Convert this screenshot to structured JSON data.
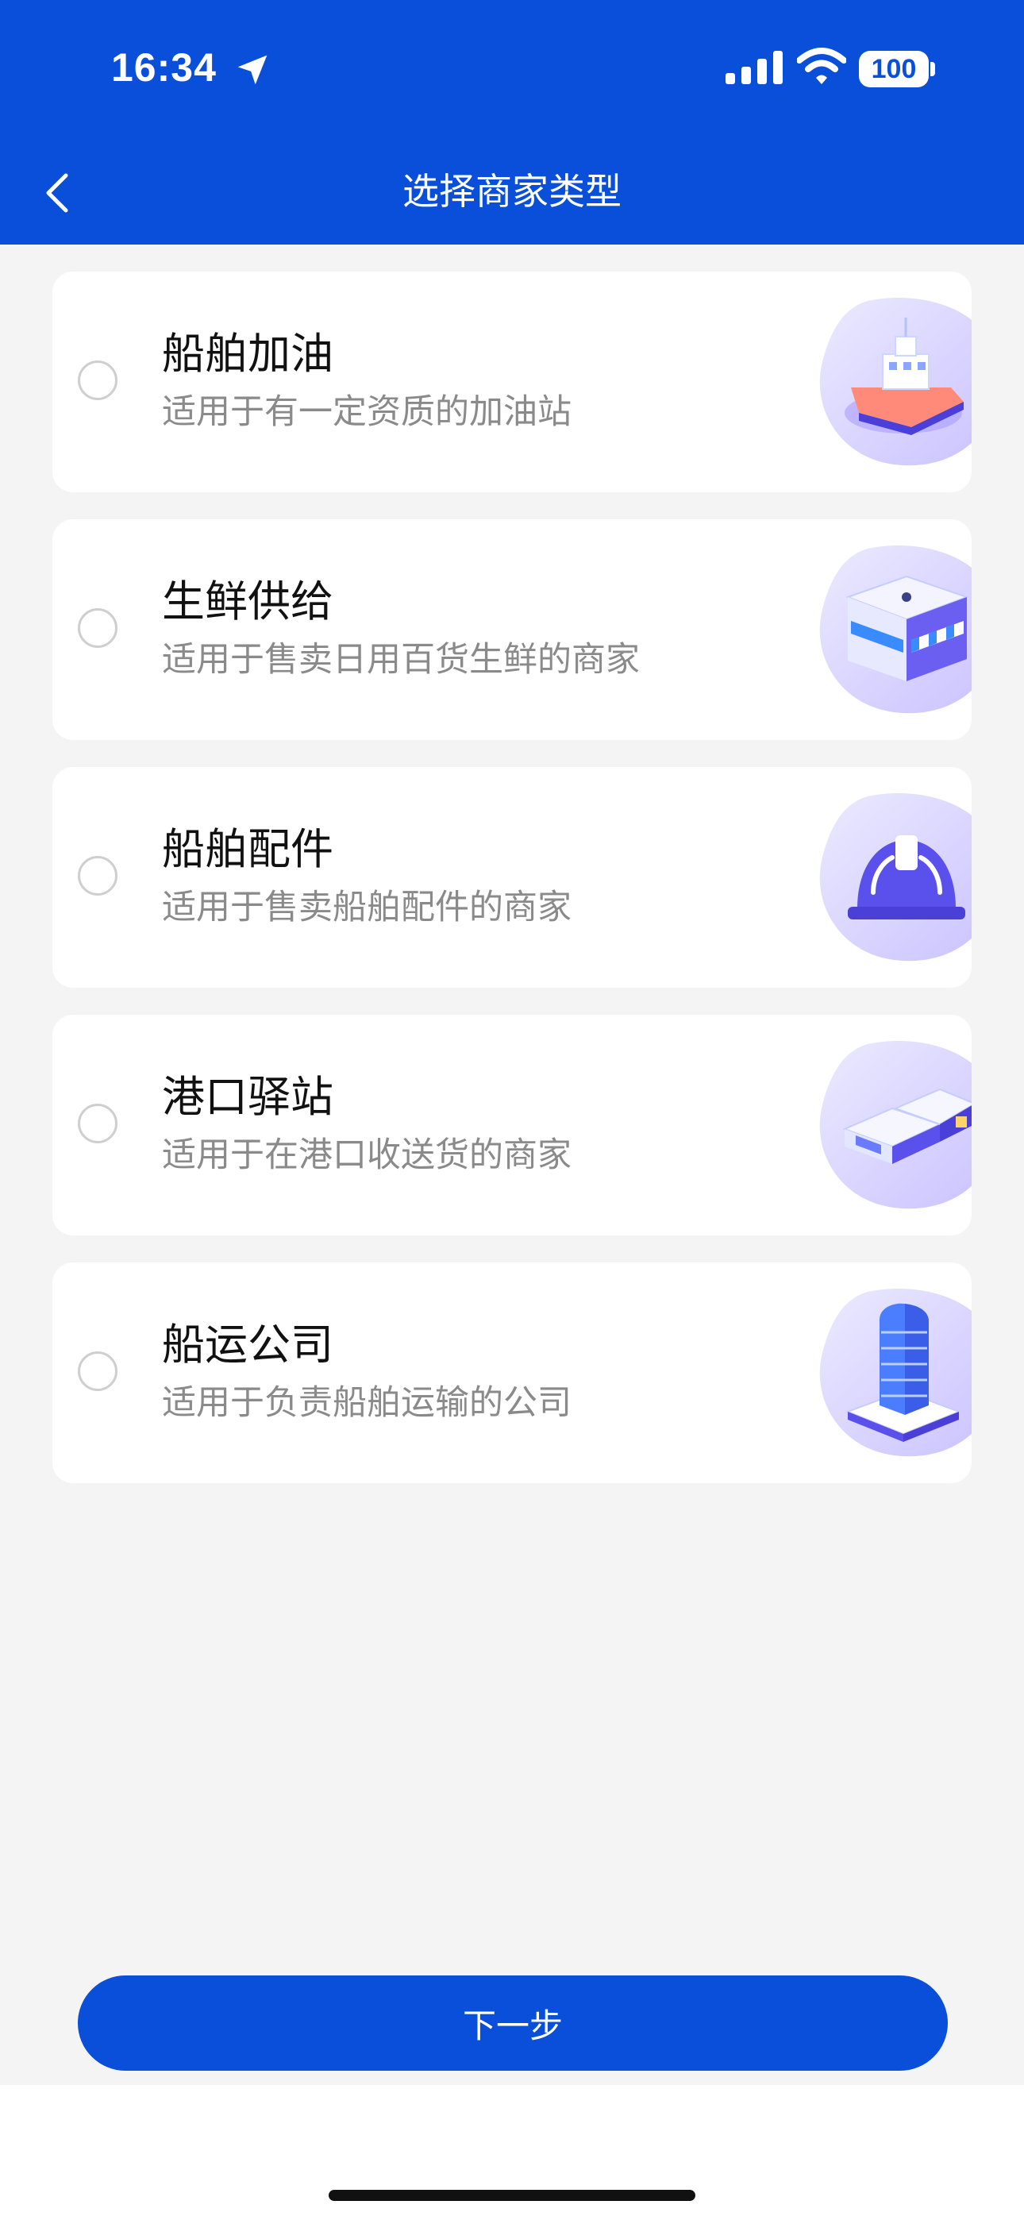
{
  "status_bar": {
    "time": "16:34",
    "battery": "100"
  },
  "header": {
    "title": "选择商家类型"
  },
  "options": [
    {
      "title": "船舶加油",
      "description": "适用于有一定资质的加油站",
      "icon": "ship-icon"
    },
    {
      "title": "生鲜供给",
      "description": "适用于售卖日用百货生鲜的商家",
      "icon": "store-icon"
    },
    {
      "title": "船舶配件",
      "description": "适用于售卖船舶配件的商家",
      "icon": "helmet-icon"
    },
    {
      "title": "港口驿站",
      "description": "适用于在港口收送货的商家",
      "icon": "warehouse-icon"
    },
    {
      "title": "船运公司",
      "description": "适用于负责船舶运输的公司",
      "icon": "building-icon"
    }
  ],
  "footer": {
    "next_label": "下一步"
  },
  "colors": {
    "primary": "#0a4fd9",
    "background": "#f4f4f5"
  }
}
